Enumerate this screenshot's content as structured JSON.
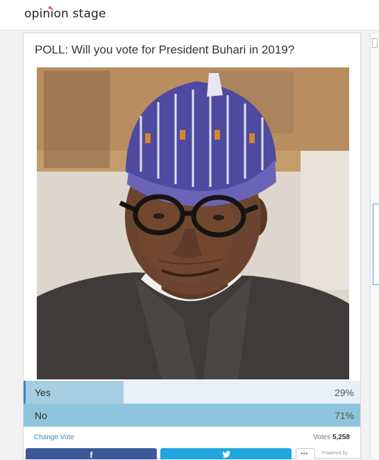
{
  "brand": {
    "name": "opinion stage",
    "dot_color": "#e8464b"
  },
  "poll": {
    "question": "POLL: Will you vote for President Buhari in 2019?",
    "photo": "portrait photo of man in black glasses and embroidered cap",
    "answers": [
      {
        "label": "Yes",
        "percent_text": "29%",
        "percent": 29
      },
      {
        "label": "No",
        "percent_text": "71%",
        "percent": 71
      }
    ],
    "change_vote": "Change Vote",
    "votes_label": "Votes",
    "votes_count": "5,258",
    "powered_by": "Powered by"
  },
  "share": {
    "facebook_icon": "facebook-icon",
    "twitter_icon": "twitter-icon",
    "more_icon": "ellipsis-icon"
  },
  "colors": {
    "bar_track": "#e6f0f5",
    "bar_yes_fill": "#a6cde1",
    "bar_no_fill": "#8ec5dc",
    "bar_accent": "#3a8ac7",
    "facebook": "#3b5998",
    "twitter": "#21a6e0",
    "link": "#3a8ac7"
  }
}
